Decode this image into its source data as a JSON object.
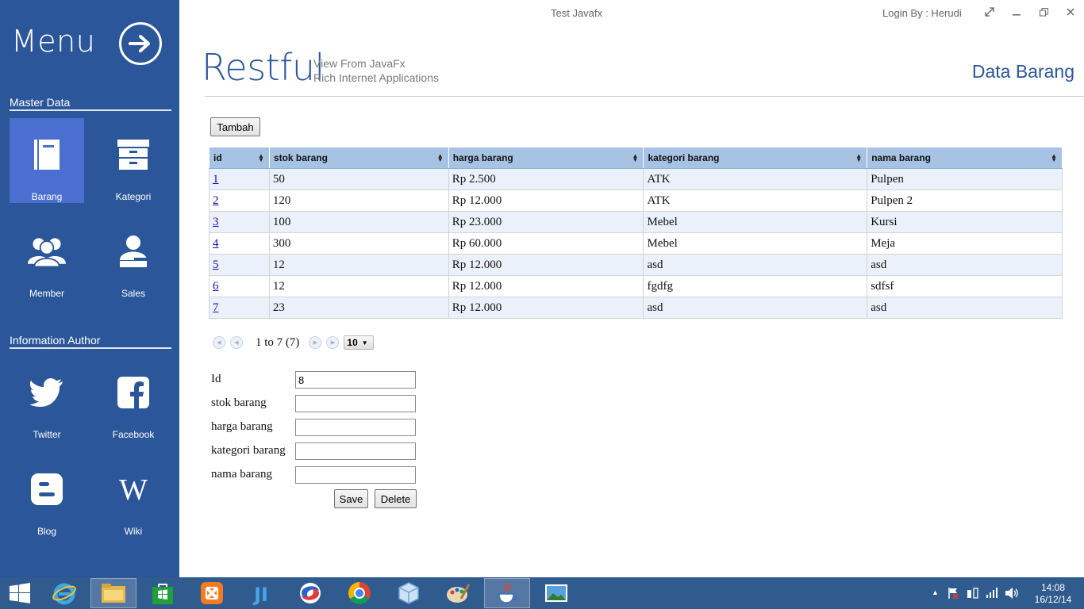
{
  "window": {
    "title": "Test Javafx",
    "login": "Login By : Herudi"
  },
  "sidebar": {
    "menu_title": "Menu",
    "master_title": "Master Data",
    "master_items": [
      {
        "label": "Barang",
        "icon": "book-icon"
      },
      {
        "label": "Kategori",
        "icon": "archive-icon"
      },
      {
        "label": "Member",
        "icon": "users-icon"
      },
      {
        "label": "Sales",
        "icon": "sales-user-icon"
      }
    ],
    "author_title": "Information Author",
    "author_items": [
      {
        "label": "Twitter",
        "icon": "twitter-icon"
      },
      {
        "label": "Facebook",
        "icon": "facebook-icon"
      },
      {
        "label": "Blog",
        "icon": "blogger-icon"
      },
      {
        "label": "Wiki",
        "icon": "wikipedia-icon"
      }
    ]
  },
  "header": {
    "brand": "Restful",
    "subtitle1": "View From JavaFx",
    "subtitle2": "Rich Internet Applications",
    "page_title": "Data Barang"
  },
  "toolbar": {
    "add_label": "Tambah"
  },
  "table": {
    "columns": [
      "id",
      "stok barang",
      "harga barang",
      "kategori barang",
      "nama barang"
    ],
    "rows": [
      [
        "1",
        "50",
        "Rp 2.500",
        "ATK",
        "Pulpen"
      ],
      [
        "2",
        "120",
        "Rp 12.000",
        "ATK",
        "Pulpen 2"
      ],
      [
        "3",
        "100",
        "Rp 23.000",
        "Mebel",
        "Kursi"
      ],
      [
        "4",
        "300",
        "Rp 60.000",
        "Mebel",
        "Meja"
      ],
      [
        "5",
        "12",
        "Rp 12.000",
        "asd",
        "asd"
      ],
      [
        "6",
        "12",
        "Rp 12.000",
        "fgdfg",
        "sdfsf"
      ],
      [
        "7",
        "23",
        "Rp 12.000",
        "asd",
        "asd"
      ]
    ]
  },
  "pager": {
    "summary": "1 to 7 (7)",
    "page_size": "10"
  },
  "form": {
    "fields": [
      {
        "label": "Id",
        "value": "8"
      },
      {
        "label": "stok barang",
        "value": ""
      },
      {
        "label": "harga barang",
        "value": ""
      },
      {
        "label": "kategori barang",
        "value": ""
      },
      {
        "label": "nama barang",
        "value": ""
      }
    ],
    "save_label": "Save",
    "delete_label": "Delete"
  },
  "taskbar": {
    "time": "14:08",
    "date": "16/12/14"
  },
  "colors": {
    "sidebar": "#2b579a",
    "active_tile": "#4a6fd0",
    "header_blue": "#2b579a",
    "table_header": "#a7c3e4",
    "row_alt": "#eaf1fa",
    "taskbar": "#2f5b8f"
  }
}
